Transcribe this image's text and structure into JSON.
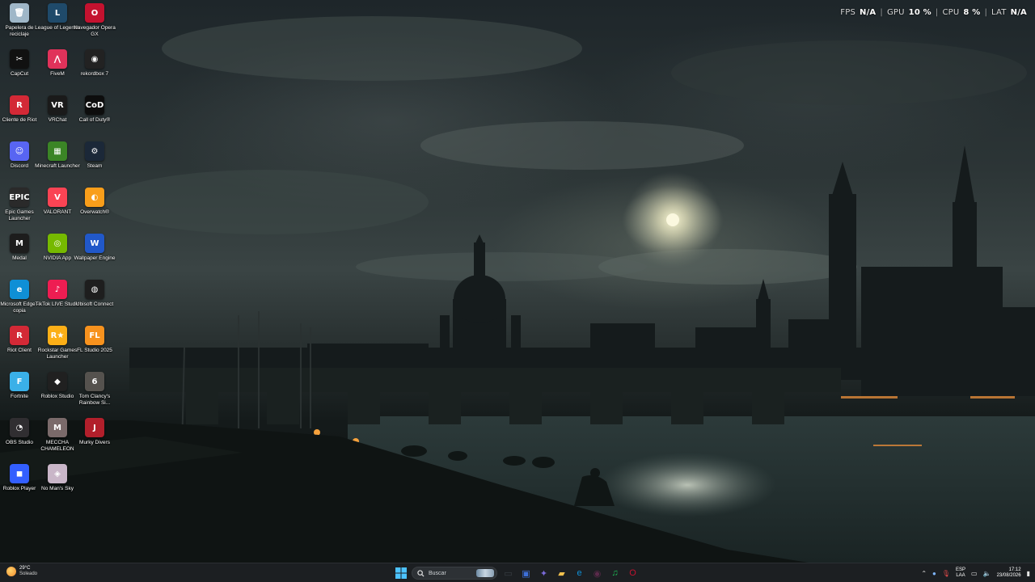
{
  "overlay": {
    "fps_label": "FPS",
    "fps_value": "N/A",
    "gpu_label": "GPU",
    "gpu_value": "10 %",
    "cpu_label": "CPU",
    "cpu_value": "8 %",
    "lat_label": "LAT",
    "lat_value": "N/A",
    "separator": "|"
  },
  "desktop_icons": [
    {
      "label": "Papelera de reciclaje",
      "icon": "recycle-bin-icon",
      "glyph": "🗑",
      "color": "#9fb7c8"
    },
    {
      "label": "League of Legends",
      "icon": "league-icon",
      "glyph": "L",
      "color": "#1f4a6a"
    },
    {
      "label": "Navegador Opera GX",
      "icon": "opera-gx-icon",
      "glyph": "O",
      "color": "#c4122f"
    },
    {
      "label": "CapCut",
      "icon": "capcut-icon",
      "glyph": "✂",
      "color": "#111111"
    },
    {
      "label": "FiveM",
      "icon": "fivem-icon",
      "glyph": "⋀",
      "color": "#e0325a"
    },
    {
      "label": "rekordbox 7",
      "icon": "rekordbox-icon",
      "glyph": "◉",
      "color": "#222222"
    },
    {
      "label": "Cliente de Riot",
      "icon": "riot-client-icon",
      "glyph": "R",
      "color": "#d32936"
    },
    {
      "label": "VRChat",
      "icon": "vrchat-icon",
      "glyph": "VR",
      "color": "#1a1a1a"
    },
    {
      "label": "Call of Duty®",
      "icon": "call-of-duty-icon",
      "glyph": "CoD",
      "color": "#0d0d0d"
    },
    {
      "label": "Discord",
      "icon": "discord-icon",
      "glyph": "☺",
      "color": "#5865f2"
    },
    {
      "label": "Minecraft Launcher",
      "icon": "minecraft-icon",
      "glyph": "▦",
      "color": "#3b8526"
    },
    {
      "label": "Steam",
      "icon": "steam-icon",
      "glyph": "⚙",
      "color": "#1b2838"
    },
    {
      "label": "Epic Games Launcher",
      "icon": "epic-games-icon",
      "glyph": "EPIC",
      "color": "#2a2a2a"
    },
    {
      "label": "VALORANT",
      "icon": "valorant-icon",
      "glyph": "V",
      "color": "#fa4454"
    },
    {
      "label": "Overwatch®",
      "icon": "overwatch-icon",
      "glyph": "◐",
      "color": "#f99e1a"
    },
    {
      "label": "Medal",
      "icon": "medal-icon",
      "glyph": "M",
      "color": "#1d1d1d"
    },
    {
      "label": "NVIDIA App",
      "icon": "nvidia-icon",
      "glyph": "◎",
      "color": "#76b900"
    },
    {
      "label": "Wallpaper Engine",
      "icon": "wallpaper-engine-icon",
      "glyph": "W",
      "color": "#2158c9"
    },
    {
      "label": "Microsoft Edge - copia",
      "icon": "edge-icon",
      "glyph": "e",
      "color": "#0f8fd6"
    },
    {
      "label": "TikTok LIVE Studio",
      "icon": "tiktok-live-icon",
      "glyph": "♪",
      "color": "#ee1d52"
    },
    {
      "label": "Ubisoft Connect",
      "icon": "ubisoft-icon",
      "glyph": "◍",
      "color": "#1e1e1e"
    },
    {
      "label": "Riot Client",
      "icon": "riot-client-2-icon",
      "glyph": "R",
      "color": "#d32936"
    },
    {
      "label": "Rockstar Games Launcher",
      "icon": "rockstar-icon",
      "glyph": "R★",
      "color": "#fcaf17"
    },
    {
      "label": "FL Studio 2025",
      "icon": "fl-studio-icon",
      "glyph": "FL",
      "color": "#f7921e"
    },
    {
      "label": "Fortnite",
      "icon": "fortnite-icon",
      "glyph": "F",
      "color": "#3ab0e8"
    },
    {
      "label": "Roblox Studio",
      "icon": "roblox-studio-icon",
      "glyph": "◆",
      "color": "#202020"
    },
    {
      "label": "Tom Clancy's Rainbow Si...",
      "icon": "rainbow-six-icon",
      "glyph": "6",
      "color": "#55524e"
    },
    {
      "label": "OBS Studio",
      "icon": "obs-icon",
      "glyph": "◔",
      "color": "#302e31"
    },
    {
      "label": "MECCHA CHAMELEON",
      "icon": "meccha-chameleon-icon",
      "glyph": "M",
      "color": "#7a6a6a"
    },
    {
      "label": "Murky Divers",
      "icon": "murky-divers-icon",
      "glyph": "J",
      "color": "#b21f2b"
    },
    {
      "label": "Roblox Player",
      "icon": "roblox-player-icon",
      "glyph": "◼",
      "color": "#335fff"
    },
    {
      "label": "No Man's Sky",
      "icon": "no-mans-sky-icon",
      "glyph": "◈",
      "color": "#c9b6c8"
    }
  ],
  "weather": {
    "temp": "29°C",
    "condition": "Soleado"
  },
  "taskbar": {
    "search_placeholder": "Buscar",
    "apps": [
      {
        "name": "task-view-icon",
        "glyph": "▭",
        "color": "#3a3f45"
      },
      {
        "name": "store-icon",
        "glyph": "▣",
        "color": "#3d6fd9"
      },
      {
        "name": "copilot-icon",
        "glyph": "✦",
        "color": "#7a6ad8"
      },
      {
        "name": "file-explorer-icon",
        "glyph": "▰",
        "color": "#f2c14e"
      },
      {
        "name": "edge-taskbar-icon",
        "glyph": "e",
        "color": "#0f8fd6"
      },
      {
        "name": "app-taskbar-icon",
        "glyph": "◉",
        "color": "#5a2a4a"
      },
      {
        "name": "spotify-icon",
        "glyph": "♫",
        "color": "#1db954"
      },
      {
        "name": "opera-gx-taskbar-icon",
        "glyph": "O",
        "color": "#c4122f"
      }
    ]
  },
  "tray": {
    "lang_1": "ESP",
    "lang_2": "LAA",
    "time": "17:12",
    "date": "23/08/2026"
  }
}
